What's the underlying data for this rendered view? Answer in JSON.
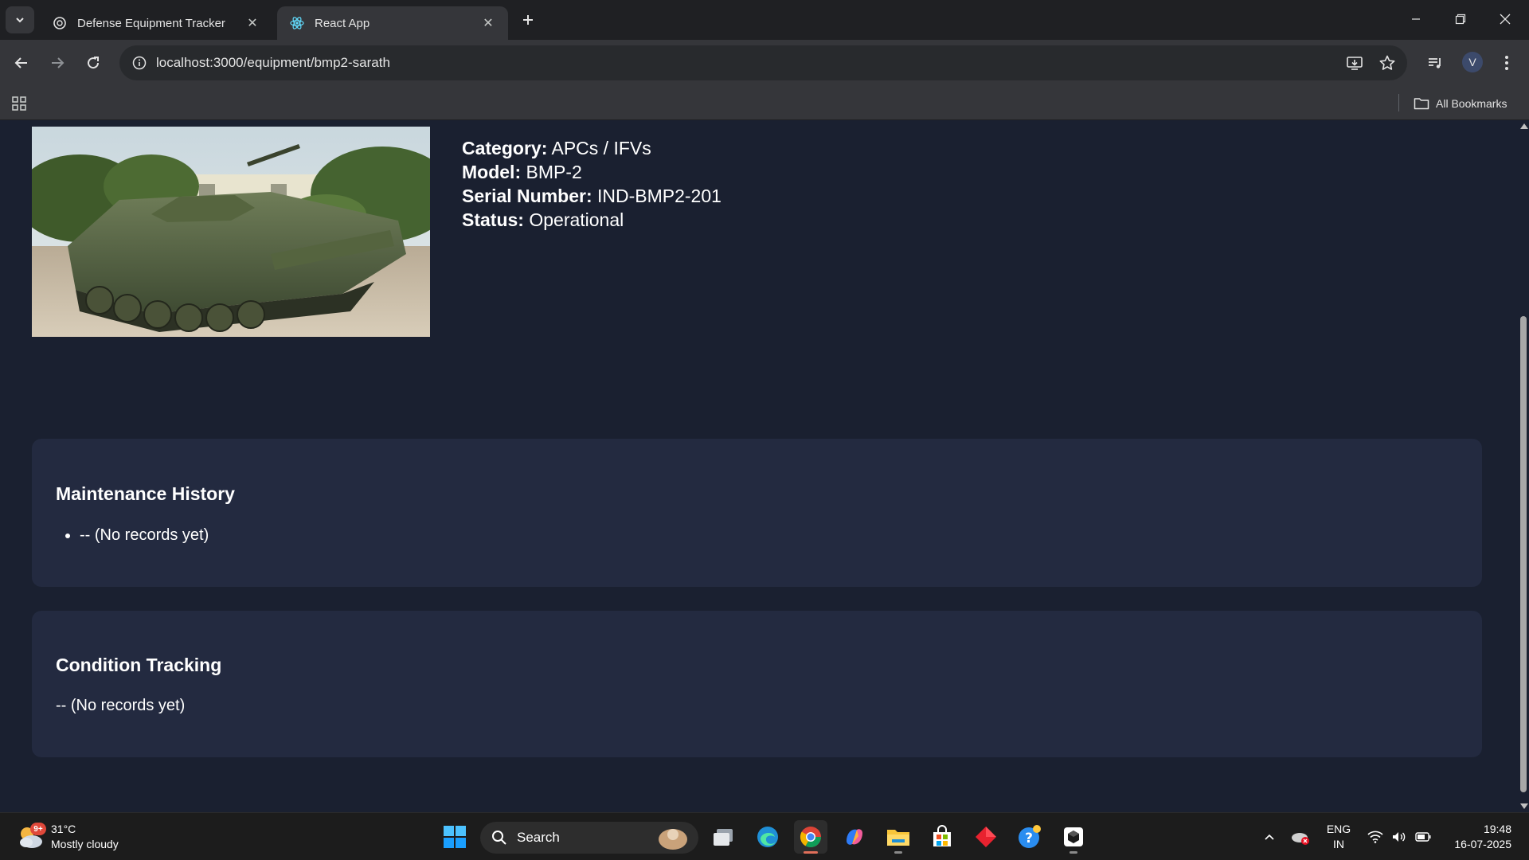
{
  "browser": {
    "tabs": [
      {
        "title": "Defense Equipment Tracker",
        "active": false
      },
      {
        "title": "React App",
        "active": true
      }
    ],
    "url": "localhost:3000/equipment/bmp2-sarath",
    "profile_initial": "V",
    "bookmarks_label": "All Bookmarks"
  },
  "equipment": {
    "image_alt": "BMP-2 infantry fighting vehicle",
    "fields": [
      {
        "label": "Category:",
        "value": "APCs / IFVs"
      },
      {
        "label": "Model:",
        "value": "BMP-2"
      },
      {
        "label": "Serial Number:",
        "value": "IND-BMP2-201"
      },
      {
        "label": "Status:",
        "value": "Operational"
      }
    ]
  },
  "maintenance": {
    "title": "Maintenance History",
    "items": [
      "-- (No records yet)"
    ]
  },
  "condition": {
    "title": "Condition Tracking",
    "text": "-- (No records yet)"
  },
  "taskbar": {
    "weather": {
      "badge": "9+",
      "temp": "31°C",
      "desc": "Mostly cloudy"
    },
    "search_label": "Search",
    "lang": {
      "line1": "ENG",
      "line2": "IN"
    },
    "time": "19:48",
    "date": "16-07-2025"
  },
  "colors": {
    "page_bg": "#1a2030",
    "card_bg": "#232a40",
    "chrome_toolbar": "#35363a",
    "taskbar_bg": "#1c1c1c"
  }
}
